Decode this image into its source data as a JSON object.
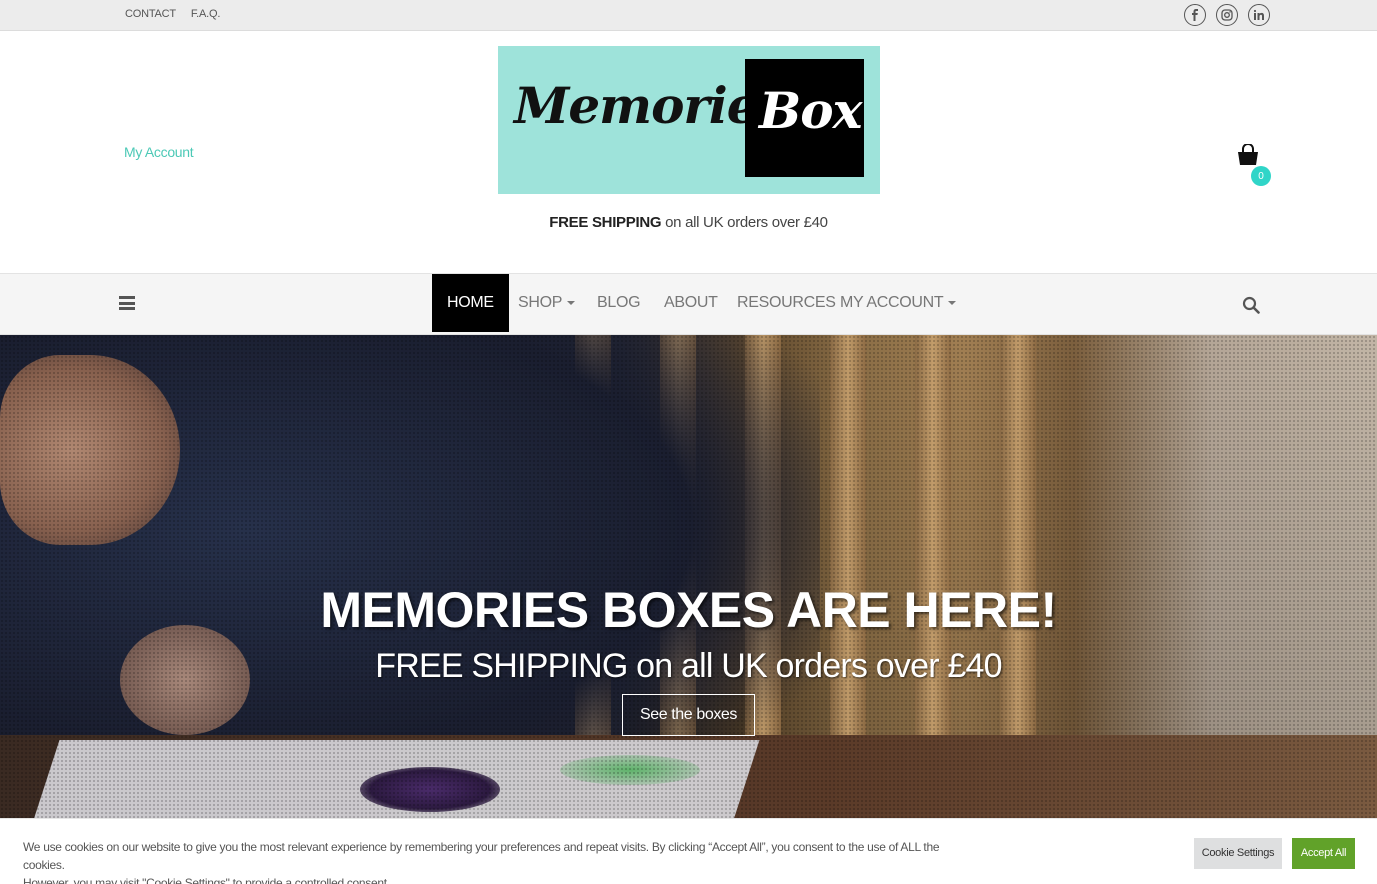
{
  "topbar": {
    "links": [
      "CONTACT",
      "F.A.Q."
    ],
    "social": [
      "facebook-icon",
      "instagram-icon",
      "linkedin-icon"
    ]
  },
  "header": {
    "my_account": "My Account",
    "logo": {
      "word1": "Memories",
      "word2": "Box"
    },
    "shipping_bold": "FREE SHIPPING",
    "shipping_rest": "on all UK orders over £40",
    "cart_count": "0"
  },
  "nav": {
    "items": [
      {
        "label": "HOME",
        "active": true
      },
      {
        "label": "SHOP",
        "dropdown": true
      },
      {
        "label": "BLOG"
      },
      {
        "label": "ABOUT"
      },
      {
        "label": "RESOURCES"
      },
      {
        "label": "MY ACCOUNT",
        "dropdown": true
      }
    ]
  },
  "hero": {
    "title": "MEMORIES BOXES ARE HERE!",
    "subtitle": "FREE SHIPPING on all UK orders over £40",
    "cta": "See the boxes"
  },
  "cookie": {
    "line1": "We use cookies on our website to give you the most relevant experience by remembering your preferences and repeat visits. By clicking “Accept All”, you consent to the use of ALL the cookies.",
    "line2": "However, you may visit \"Cookie Settings\" to provide a controlled consent.",
    "settings_label": "Cookie Settings",
    "accept_label": "Accept All"
  },
  "colors": {
    "accent": "#30d5c8",
    "logo_bg": "#9ee3da",
    "accept": "#61a229"
  }
}
